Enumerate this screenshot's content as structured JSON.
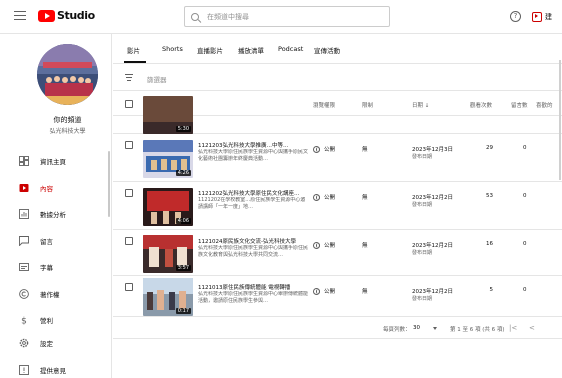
{
  "header": {
    "logo_text": "Studio",
    "search_placeholder": "在頻道中搜尋",
    "help_glyph": "?",
    "create_label": "建"
  },
  "sidebar": {
    "channel_name": "你的頻道",
    "channel_sub": "弘光科技大學",
    "items": [
      {
        "label": "資訊主頁",
        "icon": "dashboard-icon",
        "active": false
      },
      {
        "label": "內容",
        "icon": "content-icon",
        "active": true
      },
      {
        "label": "數據分析",
        "icon": "analytics-icon",
        "active": false
      },
      {
        "label": "留言",
        "icon": "comments-icon",
        "active": false
      },
      {
        "label": "字幕",
        "icon": "subtitles-icon",
        "active": false
      },
      {
        "label": "著作權",
        "icon": "copyright-icon",
        "active": false
      },
      {
        "label": "營利",
        "icon": "monetization-icon",
        "active": false
      }
    ],
    "bottom_items": [
      {
        "label": "設定",
        "icon": "settings-icon"
      },
      {
        "label": "提供意見",
        "icon": "feedback-icon"
      }
    ]
  },
  "main": {
    "tabs": [
      "影片",
      "Shorts",
      "直播影片",
      "播放清單",
      "Podcast",
      "宣傳活動"
    ],
    "filter_placeholder": "篩選器",
    "columns": {
      "video": "影片",
      "visibility": "瀏覽權限",
      "restrictions": "限制",
      "date": "日期 ↓",
      "views": "觀看次數",
      "comments": "留言數",
      "likes": "喜歡的"
    },
    "partial_row": {
      "duration": "5:30"
    },
    "rows": [
      {
        "title": "1121203弘光科技大學推廣…中等…",
        "desc": "弘光科技大學原住民族學生資源中心與攜手原民文化藝術社團籌辦年終慶典活動…",
        "duration": "4:26",
        "visibility": "公開",
        "restrictions": "無",
        "date": "2023年12月3日",
        "status": "發布日期",
        "views": "29",
        "comments": "0"
      },
      {
        "title": "1121202弘光科技大學原住民文化講座…",
        "desc": "1121202在學校教室…原住民族學生資源中心邀請講師「一年一度」地…",
        "duration": "4:06",
        "visibility": "公開",
        "restrictions": "無",
        "date": "2023年12月2日",
        "status": "發布日期",
        "views": "53",
        "comments": "0"
      },
      {
        "title": "1121024原民族文化交流-弘光科技大學",
        "desc": "弘光科技大學原住民族學生資源中心與攜手原住民族文化教育與弘光科技大學共同交流…",
        "duration": "3:57",
        "visibility": "公開",
        "restrictions": "無",
        "date": "2023年12月2日",
        "status": "發布日期",
        "views": "16",
        "comments": "0"
      },
      {
        "title": "1121013原住民族傳統體能 電視轉播",
        "desc": "弘光科技大學原住民族學生資源中心舉辦傳統體能活動，邀請原住民族學生參與…",
        "duration": "0:17",
        "visibility": "公開",
        "restrictions": "無",
        "date": "2023年12月2日",
        "status": "發布日期",
        "views": "5",
        "comments": "0"
      }
    ],
    "pager": {
      "rows_label": "每頁列數：",
      "rows_value": "30",
      "range": "第 1 至 6 項 (共 6 項)",
      "first": "|<",
      "prev": "<"
    }
  }
}
